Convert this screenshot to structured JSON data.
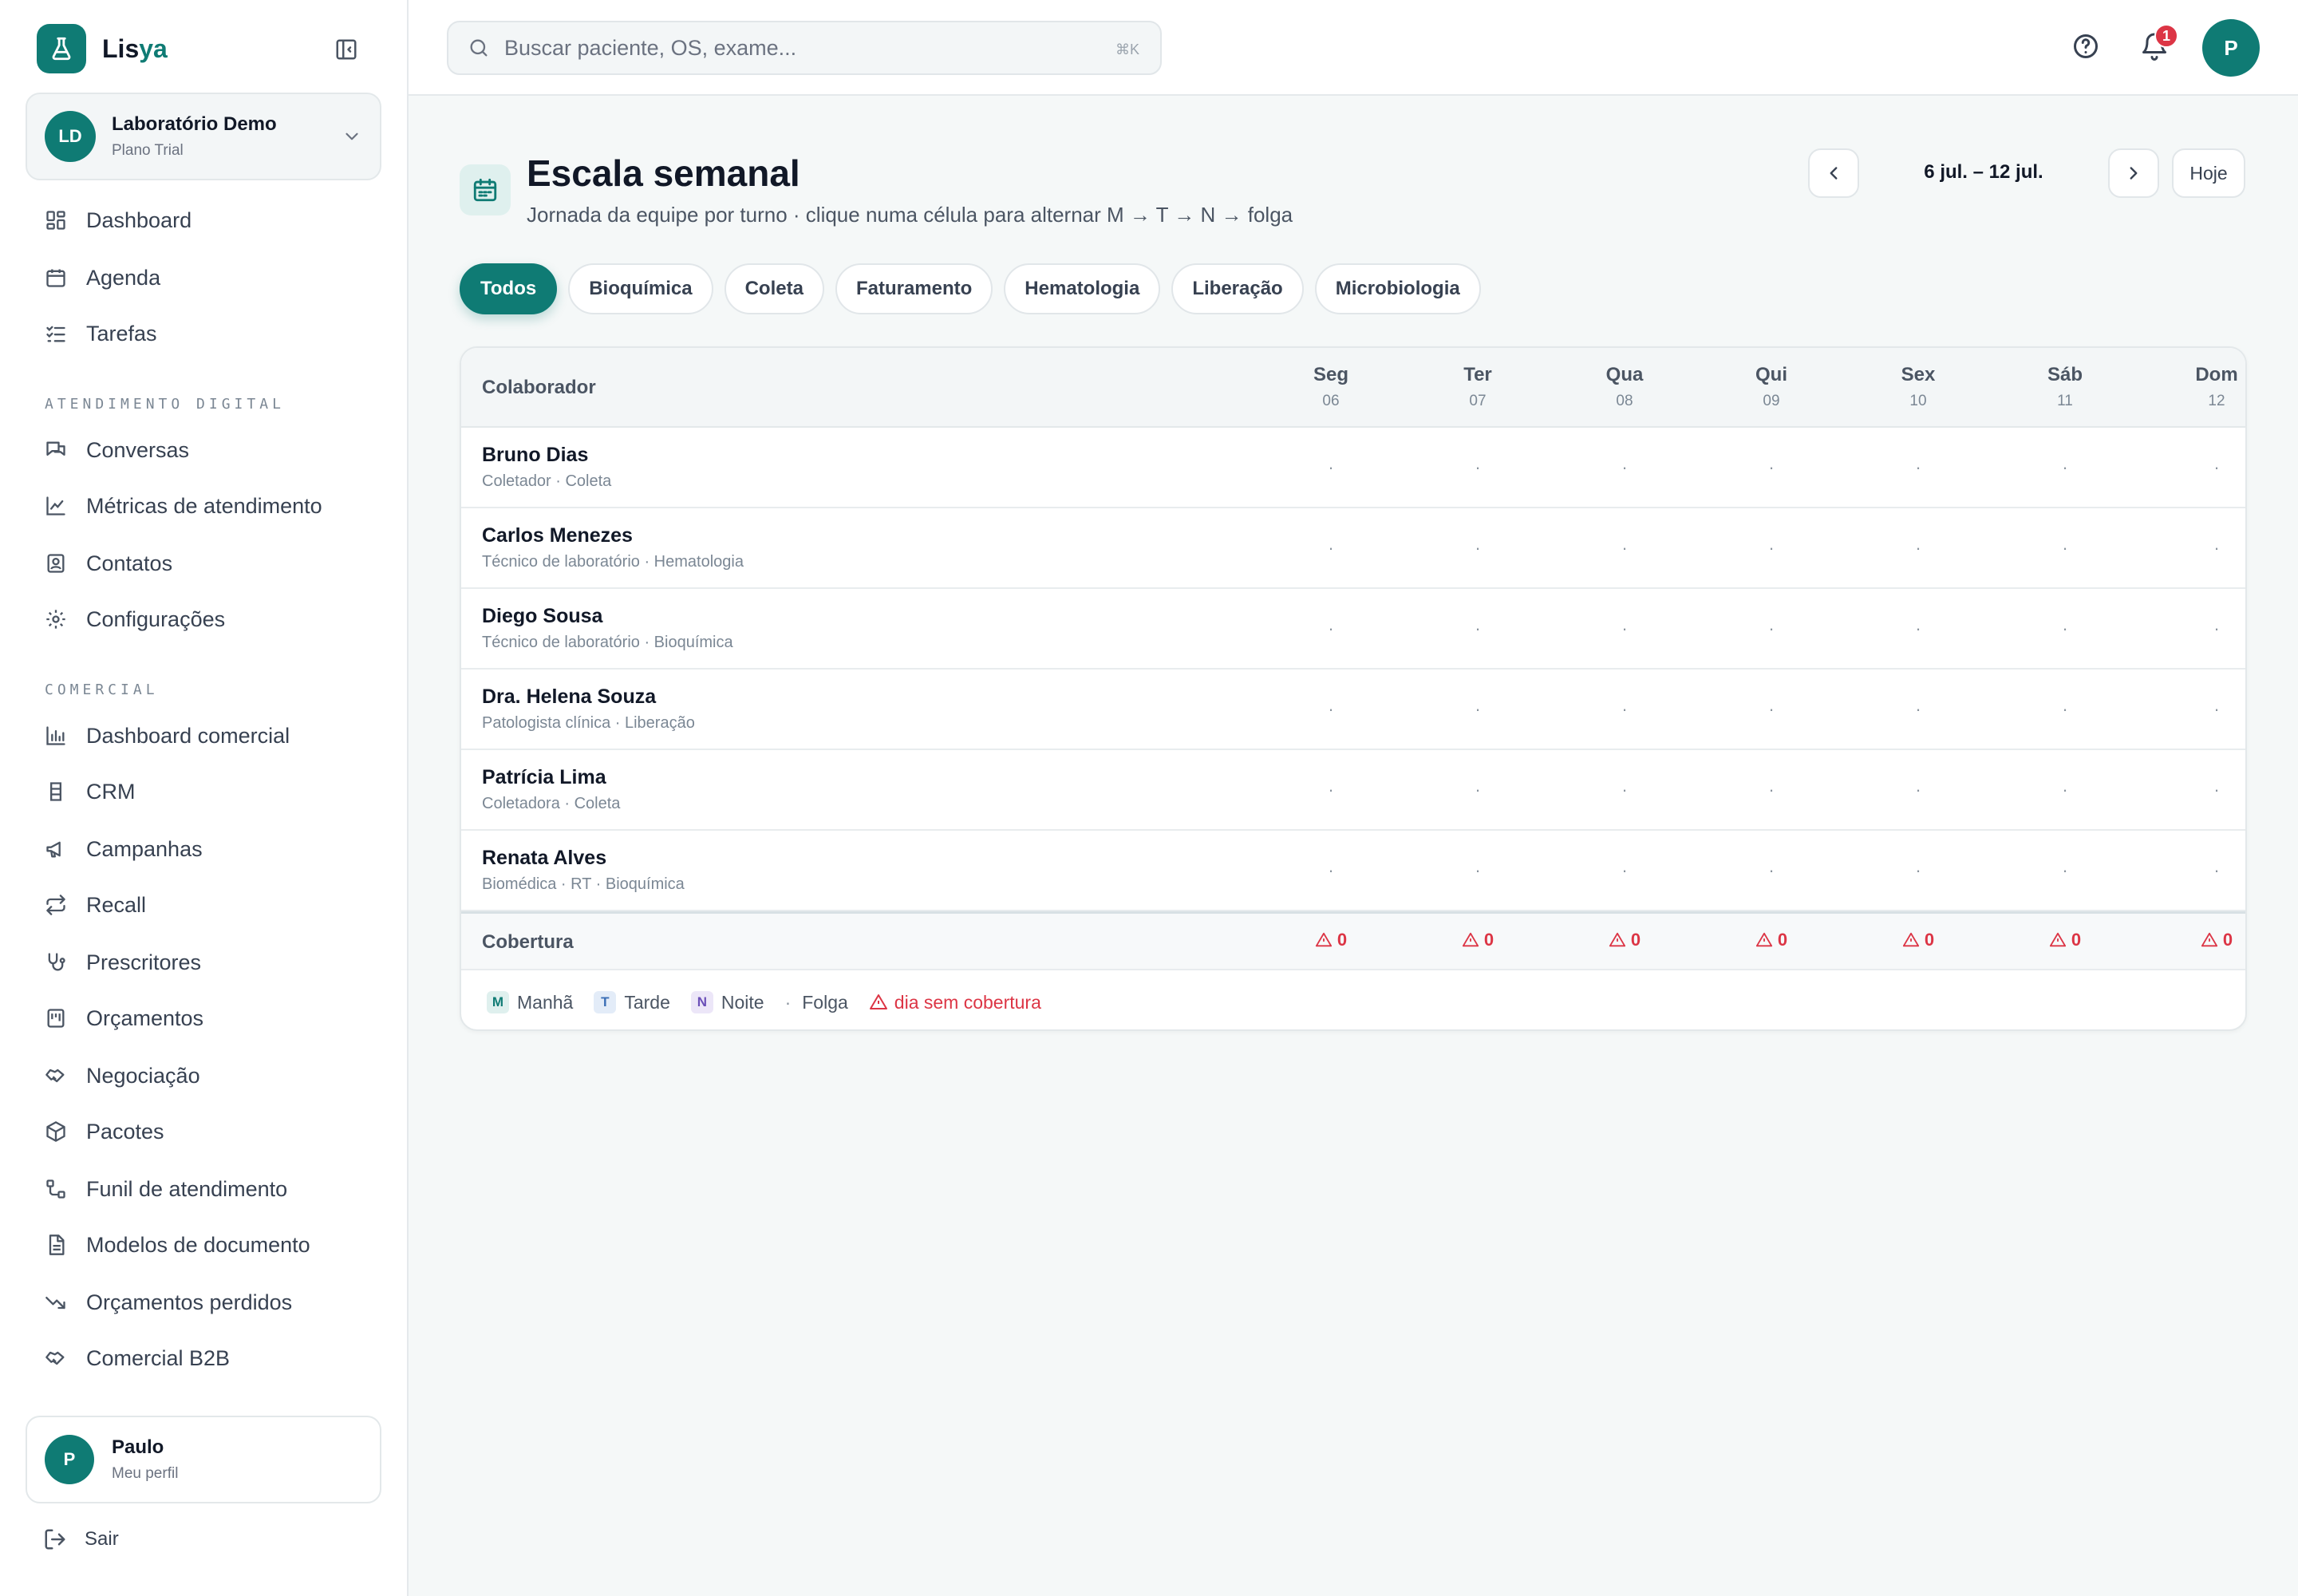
{
  "brand": {
    "name_main": "Lis",
    "name_accent": "ya"
  },
  "org": {
    "initials": "LD",
    "name": "Laboratório Demo",
    "plan": "Plano Trial"
  },
  "nav_main": [
    {
      "label": "Dashboard",
      "icon": "dashboard-icon"
    },
    {
      "label": "Agenda",
      "icon": "calendar-icon"
    },
    {
      "label": "Tarefas",
      "icon": "tasks-icon"
    }
  ],
  "section_digital": "Atendimento digital",
  "nav_digital": [
    {
      "label": "Conversas",
      "icon": "chat-icon"
    },
    {
      "label": "Métricas de atendimento",
      "icon": "chart-line-icon"
    },
    {
      "label": "Contatos",
      "icon": "contacts-icon"
    },
    {
      "label": "Configurações",
      "icon": "gear-icon"
    }
  ],
  "section_comercial": "Comercial",
  "nav_comercial": [
    {
      "label": "Dashboard comercial",
      "icon": "bar-chart-icon"
    },
    {
      "label": "CRM",
      "icon": "crm-icon"
    },
    {
      "label": "Campanhas",
      "icon": "megaphone-icon"
    },
    {
      "label": "Recall",
      "icon": "repeat-icon"
    },
    {
      "label": "Prescritores",
      "icon": "stethoscope-icon"
    },
    {
      "label": "Orçamentos",
      "icon": "quote-icon"
    },
    {
      "label": "Negociação",
      "icon": "handshake-icon"
    },
    {
      "label": "Pacotes",
      "icon": "package-icon"
    },
    {
      "label": "Funil de atendimento",
      "icon": "funnel-icon"
    },
    {
      "label": "Modelos de documento",
      "icon": "document-icon"
    },
    {
      "label": "Orçamentos perdidos",
      "icon": "trending-down-icon"
    },
    {
      "label": "Comercial B2B",
      "icon": "handshake-icon"
    }
  ],
  "user": {
    "initial": "P",
    "name": "Paulo",
    "sub": "Meu perfil"
  },
  "logout_label": "Sair",
  "search": {
    "placeholder": "Buscar paciente, OS, exame...",
    "shortcut": "⌘K"
  },
  "notifications_count": "1",
  "top_avatar": "P",
  "page": {
    "title": "Escala semanal",
    "subtitle": "Jornada da equipe por turno · clique numa célula para alternar M → T → N → folga",
    "week_range": "6 jul. – 12 jul.",
    "today_label": "Hoje"
  },
  "filters": [
    "Todos",
    "Bioquímica",
    "Coleta",
    "Faturamento",
    "Hematologia",
    "Liberação",
    "Microbiologia"
  ],
  "active_filter": "Todos",
  "table": {
    "col_header": "Colaborador",
    "days": [
      {
        "name": "Seg",
        "num": "06"
      },
      {
        "name": "Ter",
        "num": "07"
      },
      {
        "name": "Qua",
        "num": "08"
      },
      {
        "name": "Qui",
        "num": "09"
      },
      {
        "name": "Sex",
        "num": "10"
      },
      {
        "name": "Sáb",
        "num": "11"
      },
      {
        "name": "Dom",
        "num": "12"
      }
    ],
    "rows": [
      {
        "name": "Bruno Dias",
        "role": "Coletador · Coleta",
        "cells": [
          "·",
          "·",
          "·",
          "·",
          "·",
          "·",
          "·"
        ]
      },
      {
        "name": "Carlos Menezes",
        "role": "Técnico de laboratório · Hematologia",
        "cells": [
          "·",
          "·",
          "·",
          "·",
          "·",
          "·",
          "·"
        ]
      },
      {
        "name": "Diego Sousa",
        "role": "Técnico de laboratório · Bioquímica",
        "cells": [
          "·",
          "·",
          "·",
          "·",
          "·",
          "·",
          "·"
        ]
      },
      {
        "name": "Dra. Helena Souza",
        "role": "Patologista clínica · Liberação",
        "cells": [
          "·",
          "·",
          "·",
          "·",
          "·",
          "·",
          "·"
        ]
      },
      {
        "name": "Patrícia Lima",
        "role": "Coletadora · Coleta",
        "cells": [
          "·",
          "·",
          "·",
          "·",
          "·",
          "·",
          "·"
        ]
      },
      {
        "name": "Renata Alves",
        "role": "Biomédica · RT · Bioquímica",
        "cells": [
          "·",
          "·",
          "·",
          "·",
          "·",
          "·",
          "·"
        ]
      }
    ],
    "coverage_label": "Cobertura",
    "coverage": [
      "0",
      "0",
      "0",
      "0",
      "0",
      "0",
      "0"
    ]
  },
  "legend": {
    "m_badge": "M",
    "m_label": "Manhã",
    "t_badge": "T",
    "t_label": "Tarde",
    "n_badge": "N",
    "n_label": "Noite",
    "folga_mark": "·",
    "folga_label": "Folga",
    "warning_label": "dia sem cobertura"
  },
  "colors": {
    "brand": "#0f7b74",
    "danger": "#dc3545",
    "background": "#f5f8f8"
  }
}
